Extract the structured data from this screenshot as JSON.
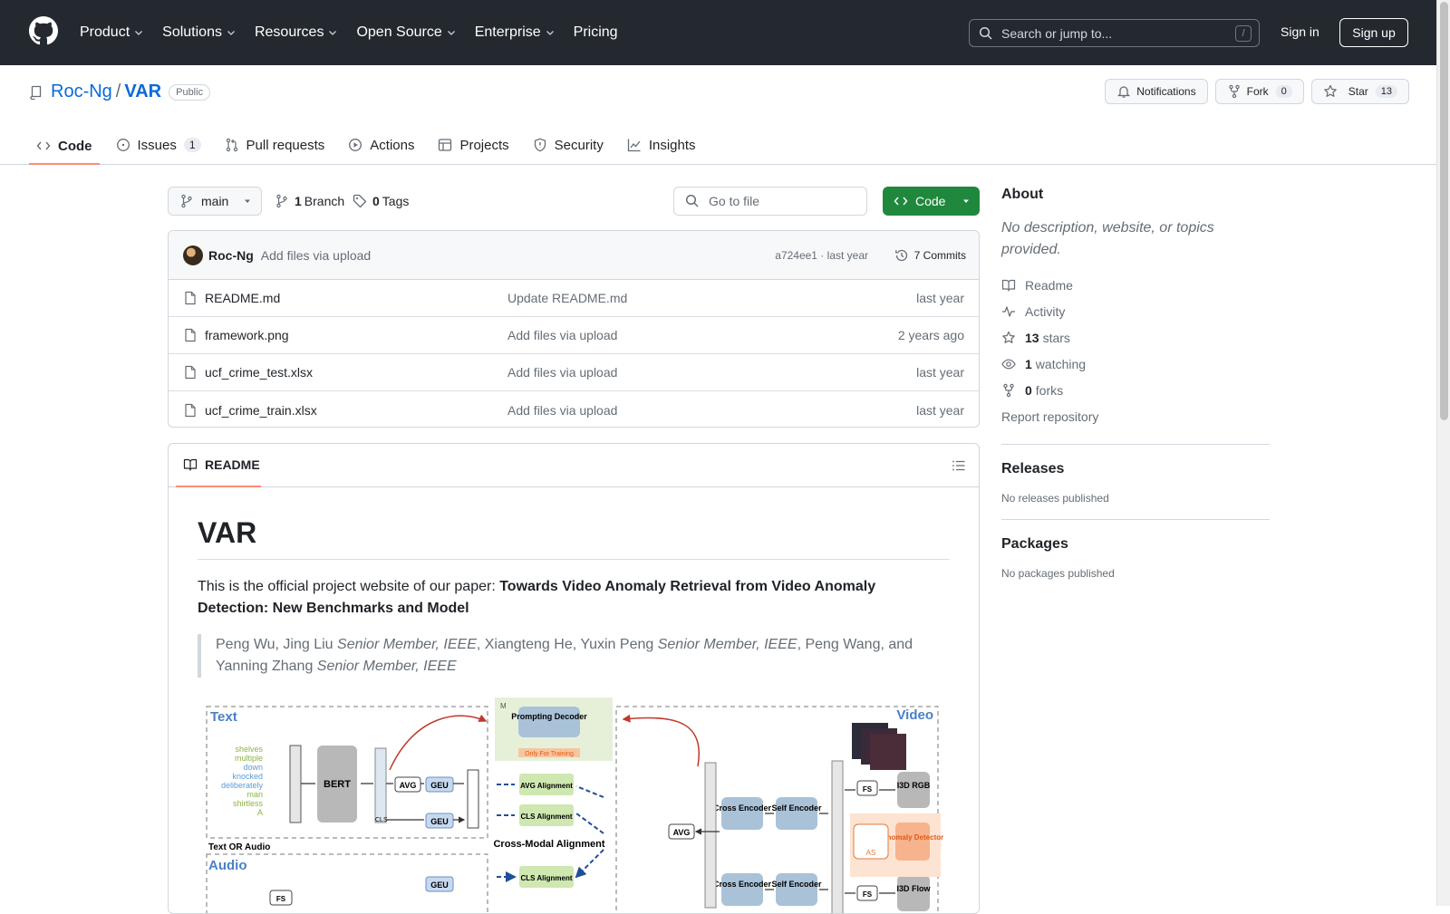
{
  "header": {
    "nav": [
      {
        "label": "Product",
        "dropdown": true
      },
      {
        "label": "Solutions",
        "dropdown": true
      },
      {
        "label": "Resources",
        "dropdown": true
      },
      {
        "label": "Open Source",
        "dropdown": true
      },
      {
        "label": "Enterprise",
        "dropdown": true
      },
      {
        "label": "Pricing",
        "dropdown": false
      }
    ],
    "search_placeholder": "Search or jump to...",
    "search_key": "/",
    "sign_in": "Sign in",
    "sign_up": "Sign up"
  },
  "repo": {
    "owner": "Roc-Ng",
    "separator": "/",
    "name": "VAR",
    "visibility": "Public",
    "notifications_label": "Notifications",
    "fork_label": "Fork",
    "fork_count": "0",
    "star_label": "Star",
    "star_count": "13",
    "tabs": [
      {
        "label": "Code",
        "count": "",
        "icon": "code-icon",
        "selected": true
      },
      {
        "label": "Issues",
        "count": "1",
        "icon": "issue-icon",
        "selected": false
      },
      {
        "label": "Pull requests",
        "count": "",
        "icon": "pull-request-icon",
        "selected": false
      },
      {
        "label": "Actions",
        "count": "",
        "icon": "play-icon",
        "selected": false
      },
      {
        "label": "Projects",
        "count": "",
        "icon": "table-icon",
        "selected": false
      },
      {
        "label": "Security",
        "count": "",
        "icon": "shield-icon",
        "selected": false
      },
      {
        "label": "Insights",
        "count": "",
        "icon": "graph-icon",
        "selected": false
      }
    ]
  },
  "filebar": {
    "branch": "main",
    "branch_count": "1",
    "branch_label": "Branch",
    "tag_count": "0",
    "tag_label": "Tags",
    "goto_placeholder": "Go to file",
    "code_label": "Code"
  },
  "latest_commit": {
    "author": "Roc-Ng",
    "message": "Add files via upload",
    "meta": "a724ee1 · last year",
    "commits_label": "7 Commits"
  },
  "files": [
    {
      "name": "README.md",
      "message": "Update README.md",
      "date": "last year"
    },
    {
      "name": "framework.png",
      "message": "Add files via upload",
      "date": "2 years ago"
    },
    {
      "name": "ucf_crime_test.xlsx",
      "message": "Add files via upload",
      "date": "last year"
    },
    {
      "name": "ucf_crime_train.xlsx",
      "message": "Add files via upload",
      "date": "last year"
    }
  ],
  "readme": {
    "tab_label": "README",
    "title": "VAR",
    "intro": "This is the official project website of our paper: ",
    "paper_title": "Towards Video Anomaly Retrieval from Video Anomaly Detection: New Benchmarks and Model",
    "authors": [
      {
        "name": "Peng Wu, Jing Liu ",
        "role": "Senior Member, IEEE"
      },
      {
        "name": ", Xiangteng He, Yuxin Peng ",
        "role": "Senior Member, IEEE"
      },
      {
        "name": ", Peng Wang, and Yanning Zhang ",
        "role": "Senior Member, IEEE"
      }
    ],
    "figure_labels": {
      "text": "Text",
      "video": "Video",
      "audio": "Audio",
      "text_or_audio": "Text OR Audio",
      "bert": "BERT",
      "avg": "AVG",
      "geu": "GEU",
      "cls": "CLS",
      "prompting_decoder": "Prompting Decoder",
      "only_training": "Only For Training",
      "avg_alignment": "AVG Alignment",
      "cls_alignment": "CLS Alignment",
      "cross_modal": "Cross-Modal Alignment",
      "cross_encoder": "Cross Encoder",
      "self_encoder": "Self Encoder",
      "i3d_rgb": "I3D RGB",
      "i3d_flow": "I3D Flow",
      "fs": "FS",
      "pe_se": "PE + SE",
      "anomaly_detector": "Anomaly Detector",
      "as": "AS",
      "m": "M",
      "words": [
        "shelves",
        "multiple",
        "down",
        "knocked",
        "deliberately",
        "man",
        "shirtless",
        "A"
      ]
    }
  },
  "sidebar": {
    "about_title": "About",
    "about_desc": "No description, website, or topics provided.",
    "items": [
      {
        "icon": "book-icon",
        "count": "",
        "label": "Readme"
      },
      {
        "icon": "pulse-icon",
        "count": "",
        "label": "Activity"
      },
      {
        "icon": "star-icon",
        "count": "13",
        "label": "stars"
      },
      {
        "icon": "eye-icon",
        "count": "1",
        "label": "watching"
      },
      {
        "icon": "fork-icon",
        "count": "0",
        "label": "forks"
      }
    ],
    "report": "Report repository",
    "releases_title": "Releases",
    "releases_empty": "No releases published",
    "packages_title": "Packages",
    "packages_empty": "No packages published"
  },
  "colors": {
    "header_bg": "#24292f",
    "link": "#0969da",
    "primary_button": "#1f883d",
    "tab_underline": "#fd8c73"
  }
}
